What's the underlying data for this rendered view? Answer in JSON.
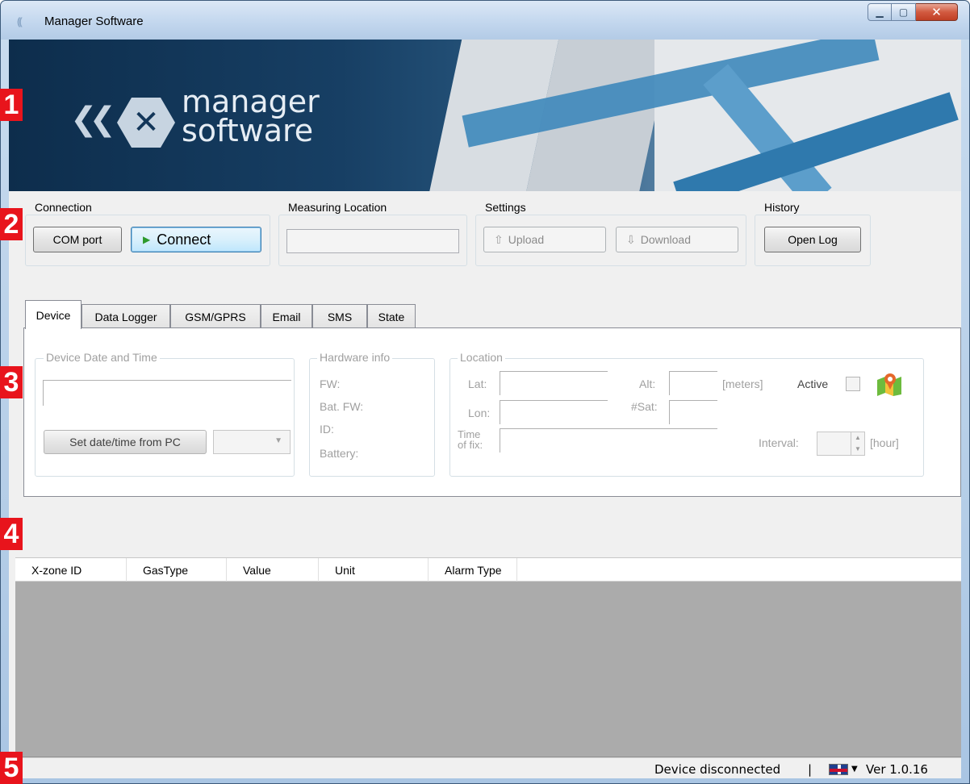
{
  "window": {
    "title": "Manager Software"
  },
  "banner": {
    "logo_line1": "manager",
    "logo_line2": "software"
  },
  "groups": {
    "connection": {
      "label": "Connection",
      "com_port": "COM port",
      "connect": "Connect"
    },
    "measuring_location": {
      "label": "Measuring Location",
      "value": ""
    },
    "settings": {
      "label": "Settings",
      "upload": "Upload",
      "download": "Download"
    },
    "history": {
      "label": "History",
      "open_log": "Open Log"
    }
  },
  "tabs": [
    {
      "label": "Device",
      "active": true
    },
    {
      "label": "Data Logger"
    },
    {
      "label": "GSM/GPRS"
    },
    {
      "label": "Email"
    },
    {
      "label": "SMS"
    },
    {
      "label": "State"
    }
  ],
  "device_tab": {
    "date_time": {
      "label": "Device Date and Time",
      "value": "",
      "set_button": "Set date/time from PC",
      "select_value": ""
    },
    "hardware": {
      "label": "Hardware info",
      "fw": "FW:",
      "bat_fw": "Bat. FW:",
      "id": "ID:",
      "battery": "Battery:"
    },
    "location": {
      "label": "Location",
      "lat": "Lat:",
      "lon": "Lon:",
      "alt": "Alt:",
      "sat": "#Sat:",
      "time_fix_1": "Time",
      "time_fix_2": "of fix:",
      "meters": "[meters]",
      "active": "Active",
      "interval": "Interval:",
      "hour": "[hour]",
      "map_icon": "map-pin-icon"
    }
  },
  "grid": {
    "columns": [
      "X-zone ID",
      "GasType",
      "Value",
      "Unit",
      "Alarm Type"
    ]
  },
  "status": {
    "state": "Device disconnected",
    "separator": "|",
    "version": "Ver 1.0.16"
  },
  "badges": [
    "1",
    "2",
    "3",
    "4",
    "5"
  ]
}
